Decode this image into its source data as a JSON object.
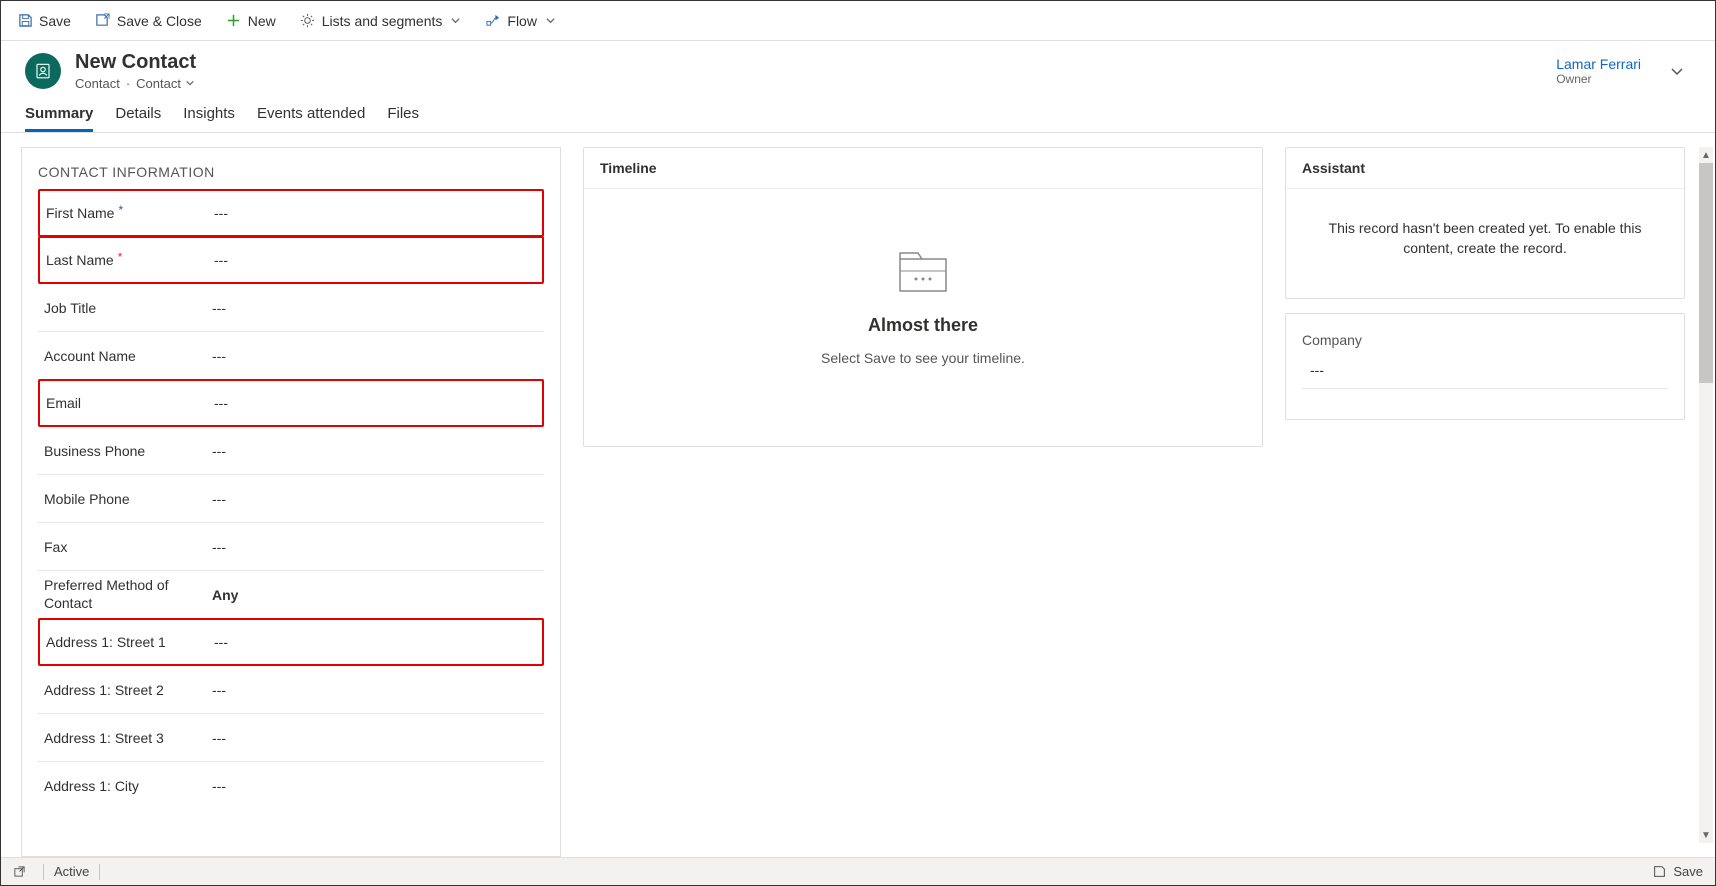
{
  "cmd": {
    "save": "Save",
    "save_close": "Save & Close",
    "new": "New",
    "lists": "Lists and segments",
    "flow": "Flow"
  },
  "header": {
    "title": "New Contact",
    "entity": "Contact",
    "form": "Contact",
    "owner_name": "Lamar Ferrari",
    "owner_label": "Owner"
  },
  "tabs": {
    "summary": "Summary",
    "details": "Details",
    "insights": "Insights",
    "events": "Events attended",
    "files": "Files"
  },
  "contact_section": {
    "title": "CONTACT INFORMATION",
    "fields": {
      "first_name": {
        "label": "First Name",
        "value": "---"
      },
      "last_name": {
        "label": "Last Name",
        "value": "---"
      },
      "job_title": {
        "label": "Job Title",
        "value": "---"
      },
      "account_name": {
        "label": "Account Name",
        "value": "---"
      },
      "email": {
        "label": "Email",
        "value": "---"
      },
      "business_phone": {
        "label": "Business Phone",
        "value": "---"
      },
      "mobile_phone": {
        "label": "Mobile Phone",
        "value": "---"
      },
      "fax": {
        "label": "Fax",
        "value": "---"
      },
      "pref_contact": {
        "label": "Preferred Method of Contact",
        "value": "Any"
      },
      "addr1_street1": {
        "label": "Address 1: Street 1",
        "value": "---"
      },
      "addr1_street2": {
        "label": "Address 1: Street 2",
        "value": "---"
      },
      "addr1_street3": {
        "label": "Address 1: Street 3",
        "value": "---"
      },
      "addr1_city": {
        "label": "Address 1: City",
        "value": "---"
      }
    }
  },
  "timeline": {
    "title": "Timeline",
    "heading": "Almost there",
    "sub": "Select Save to see your timeline."
  },
  "assistant": {
    "title": "Assistant",
    "message": "This record hasn't been created yet. To enable this content, create the record."
  },
  "company": {
    "title": "Company",
    "value": "---"
  },
  "status": {
    "state": "Active",
    "save": "Save"
  }
}
